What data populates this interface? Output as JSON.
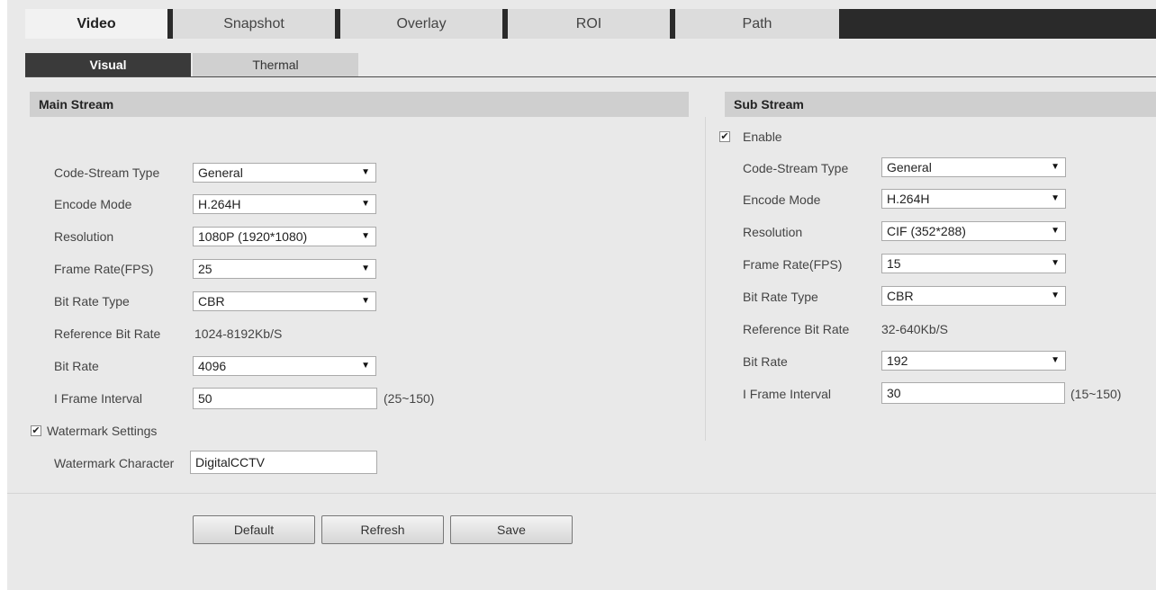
{
  "tabs": {
    "main": [
      {
        "label": "Video"
      },
      {
        "label": "Snapshot"
      },
      {
        "label": "Overlay"
      },
      {
        "label": "ROI"
      },
      {
        "label": "Path"
      }
    ],
    "sub": [
      {
        "label": "Visual"
      },
      {
        "label": "Thermal"
      }
    ]
  },
  "main_stream": {
    "title": "Main Stream",
    "labels": {
      "code_stream_type": "Code-Stream Type",
      "encode_mode": "Encode Mode",
      "resolution": "Resolution",
      "frame_rate": "Frame Rate(FPS)",
      "bit_rate_type": "Bit Rate Type",
      "reference_bit_rate": "Reference Bit Rate",
      "bit_rate": "Bit Rate",
      "i_frame_interval": "I Frame Interval",
      "watermark_settings": "Watermark Settings",
      "watermark_character": "Watermark Character"
    },
    "values": {
      "code_stream_type": "General",
      "encode_mode": "H.264H",
      "resolution": "1080P (1920*1080)",
      "frame_rate": "25",
      "bit_rate_type": "CBR",
      "reference_bit_rate": "1024-8192Kb/S",
      "bit_rate": "4096",
      "i_frame_interval": "50",
      "i_frame_range": "(25~150)",
      "watermark_character": "DigitalCCTV"
    },
    "watermark_checked": "✔",
    "dropdown_arrow": "▼"
  },
  "sub_stream": {
    "title": "Sub Stream",
    "enable_label": "Enable",
    "enable_checked": "✔",
    "labels": {
      "code_stream_type": "Code-Stream Type",
      "encode_mode": "Encode Mode",
      "resolution": "Resolution",
      "frame_rate": "Frame Rate(FPS)",
      "bit_rate_type": "Bit Rate Type",
      "reference_bit_rate": "Reference Bit Rate",
      "bit_rate": "Bit Rate",
      "i_frame_interval": "I Frame Interval"
    },
    "values": {
      "code_stream_type": "General",
      "encode_mode": "H.264H",
      "resolution": "CIF (352*288)",
      "frame_rate": "15",
      "bit_rate_type": "CBR",
      "reference_bit_rate": "32-640Kb/S",
      "bit_rate": "192",
      "i_frame_interval": "30",
      "i_frame_range": "(15~150)"
    },
    "dropdown_arrow": "▼"
  },
  "buttons": {
    "default": "Default",
    "refresh": "Refresh",
    "save": "Save"
  },
  "colors": {
    "tab_bar_dark": "#2a2a2a",
    "active_subtab": "#3a3a3a",
    "section_header": "#cfcfcf",
    "panel": "#e9e9e9"
  }
}
